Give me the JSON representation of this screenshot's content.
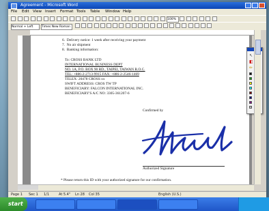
{
  "window": {
    "title": "Agreement - Microsoft Word"
  },
  "menu": [
    "File",
    "Edit",
    "View",
    "Insert",
    "Format",
    "Tools",
    "Table",
    "Window",
    "Help"
  ],
  "toolbar": {
    "style": "Normal + Left",
    "font": "Times New Roman",
    "zoom": "100%"
  },
  "document": {
    "list": [
      {
        "num": "6.",
        "text": "Delivery notice: 1 week after receiving your payment"
      },
      {
        "num": "7.",
        "text": "No air shipment"
      },
      {
        "num": "8.",
        "text": "Banking information:"
      }
    ],
    "bank_lines": [
      "To: CROSS BANK LTD",
      "INTERNATIONAL BUSINESS DEPT",
      "NO. 1A, P.O. BOX 90 RD., TAIPEI, TAIWAN R.O.C.",
      "TEL: +886-2-2713-9915 FAX: +886-2-2546-1469",
      "TELEX: 20478 CROSS xx",
      "SWIFT ADDRESS: CROS TW TP",
      "BENEFICIARY: FALCON INTERNATIONAL INC.",
      "BENEFICIARY'S A/C NO: 3305-361207-6"
    ],
    "confirmed_by": "Confirmed by",
    "signature_label": "Authorized Signature",
    "footer_note": "* Please return this ID with your authorized signature for our confirmation."
  },
  "status": {
    "page": "Page 1",
    "sec": "Sec 1",
    "pages": "1/1",
    "at": "At 5.4\"",
    "ln": "Ln 28",
    "col": "Col 35",
    "lang": "English (U.S.)"
  },
  "taskbar": {
    "start": "start"
  },
  "palette_colors": [
    "#000000",
    "#ff0000",
    "#00a000",
    "#0000ff",
    "#ffff00",
    "#ff00ff",
    "#00ffff",
    "#808080",
    "#800000",
    "#008000",
    "#000080",
    "#808000",
    "#800080",
    "#008080",
    "#c0c0c0",
    "#ffffff"
  ],
  "colors": {
    "signature_ink": "#1a2fa8",
    "title_bar": "#0b46b5"
  }
}
